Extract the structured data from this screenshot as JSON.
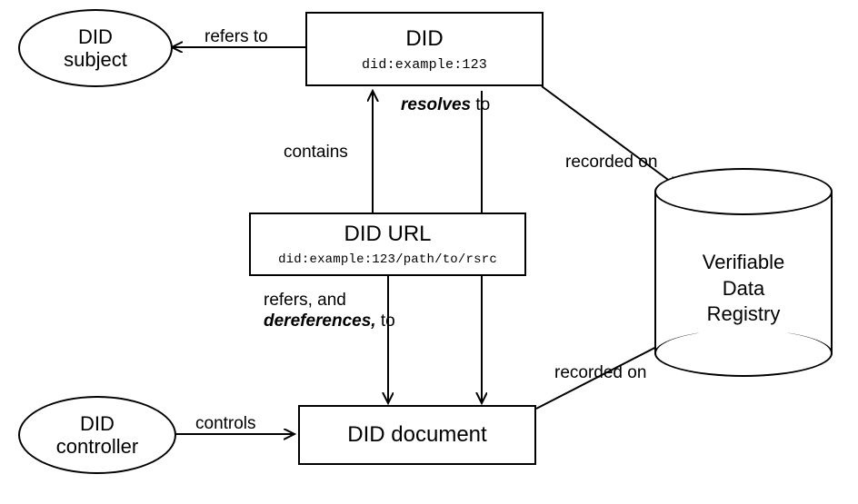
{
  "nodes": {
    "did_subject": {
      "line1": "DID",
      "line2": "subject"
    },
    "did_box": {
      "title": "DID",
      "sub": "did:example:123"
    },
    "did_url_box": {
      "title": "DID URL",
      "sub": "did:example:123/path/to/rsrc"
    },
    "did_document": {
      "title": "DID document"
    },
    "did_controller": {
      "line1": "DID",
      "line2": "controller"
    },
    "vdr": {
      "line1": "Verifiable",
      "line2": "Data",
      "line3": "Registry"
    }
  },
  "labels": {
    "refers_to": "refers to",
    "resolves_to_pre": "resolves",
    "resolves_to_post": " to",
    "recorded_on_1": "recorded on",
    "recorded_on_2": "recorded on",
    "contains": "contains",
    "deref_pre": "refers, and",
    "deref_ital": "dereferences,",
    "deref_post": " to",
    "controls": "controls"
  }
}
